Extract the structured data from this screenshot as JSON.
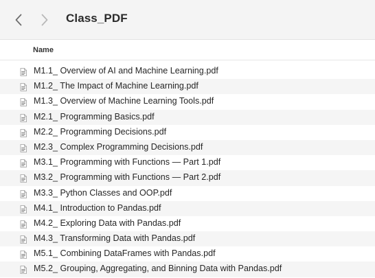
{
  "toolbar": {
    "back_icon": "chevron-left-icon",
    "forward_icon": "chevron-right-icon",
    "folder_title": "Class_PDF"
  },
  "list_header": {
    "name_label": "Name"
  },
  "files": [
    {
      "name": "M1.1_ Overview of AI and Machine Learning.pdf",
      "icon": "pdf-document-icon"
    },
    {
      "name": "M1.2_ The Impact of Machine Learning.pdf",
      "icon": "pdf-document-icon"
    },
    {
      "name": "M1.3_ Overview of Machine Learning Tools.pdf",
      "icon": "pdf-document-icon"
    },
    {
      "name": "M2.1_ Programming Basics.pdf",
      "icon": "pdf-document-icon"
    },
    {
      "name": "M2.2_ Programming Decisions.pdf",
      "icon": "pdf-document-icon"
    },
    {
      "name": "M2.3_ Complex Programming Decisions.pdf",
      "icon": "pdf-document-icon"
    },
    {
      "name": "M3.1_ Programming with Functions — Part 1.pdf",
      "icon": "pdf-document-icon"
    },
    {
      "name": "M3.2_ Programming with Functions — Part 2.pdf",
      "icon": "pdf-document-icon"
    },
    {
      "name": "M3.3_ Python Classes and OOP.pdf",
      "icon": "pdf-document-icon"
    },
    {
      "name": "M4.1_ Introduction to Pandas.pdf",
      "icon": "pdf-document-icon"
    },
    {
      "name": "M4.2_ Exploring Data with Pandas.pdf",
      "icon": "pdf-document-icon"
    },
    {
      "name": "M4.3_ Transforming Data with Pandas.pdf",
      "icon": "pdf-document-icon"
    },
    {
      "name": "M5.1_ Combining DataFrames with Pandas.pdf",
      "icon": "pdf-document-icon"
    },
    {
      "name": "M5.2_ Grouping, Aggregating, and Binning Data with Pandas.pdf",
      "icon": "pdf-document-icon"
    }
  ],
  "colors": {
    "toolbar_bg": "#f4f4f4",
    "alt_row_bg": "#f5f5f5",
    "chevron_active": "#6e6e6e",
    "chevron_disabled": "#b8b8b8"
  }
}
